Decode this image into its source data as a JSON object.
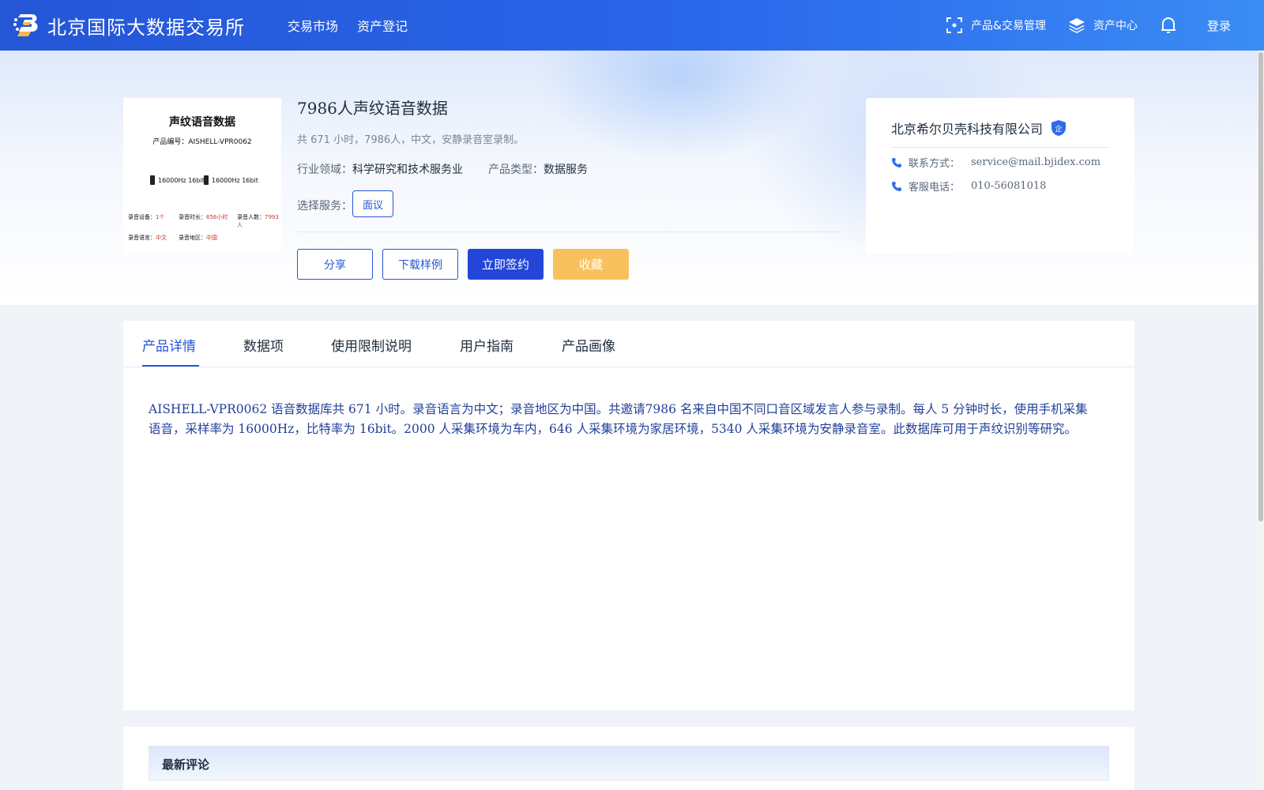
{
  "header": {
    "brand": "北京国际大数据交易所",
    "nav": [
      "交易市场",
      "资产登记"
    ],
    "right": {
      "product_mgmt": "产品&交易管理",
      "asset_center": "资产中心",
      "login": "登录"
    }
  },
  "product": {
    "title": "7986人声纹语音数据",
    "desc": "共 671 小时，7986人，中文，安静录音室录制。",
    "industry_label": "行业领域：",
    "industry": "科学研究和技术服务业",
    "type_label": "产品类型：",
    "type": "数据服务",
    "service_label": "选择服务：",
    "service_option": "面议",
    "buttons": {
      "share": "分享",
      "download_sample": "下载样例",
      "sign": "立即签约",
      "favorite": "收藏"
    },
    "thumbnail": {
      "title": "声纹语音数据",
      "code": "产品编号：AISHELL-VPR0062",
      "spec1": "16000Hz 16bit",
      "spec2": "16000Hz 16bit",
      "row1": {
        "l1": "录音设备：",
        "v1": "1个",
        "l2": "录音时长：",
        "v2": "656小时",
        "l3": "录音人数：",
        "v3": "7993人"
      },
      "row2": {
        "l1": "录音语言：",
        "v1": "中文",
        "l2": "录音地区：",
        "v2": "中国"
      }
    }
  },
  "company": {
    "name": "北京希尔贝壳科技有限公司",
    "badge": "企",
    "contact_label": "联系方式：",
    "contact": "service@mail.bjidex.com",
    "phone_label": "客服电话：",
    "phone": "010-56081018"
  },
  "tabs": [
    "产品详情",
    "数据项",
    "使用限制说明",
    "用户指南",
    "产品画像"
  ],
  "detail_text": "AISHELL-VPR0062 语音数据库共 671 小时。录音语言为中文；录音地区为中国。共邀请7986 名来自中国不同口音区域发言人参与录制。每人 5 分钟时长，使用手机采集语音，采样率为 16000Hz，比特率为 16bit。2000 人采集环境为车内，646 人采集环境为家居环境，5340 人采集环境为安静录音室。此数据库可用于声纹识别等研究。",
  "comments": {
    "title": "最新评论"
  },
  "colors": {
    "primary": "#2456d6",
    "favorite": "#f7c25d",
    "detail_text": "#22409a"
  }
}
